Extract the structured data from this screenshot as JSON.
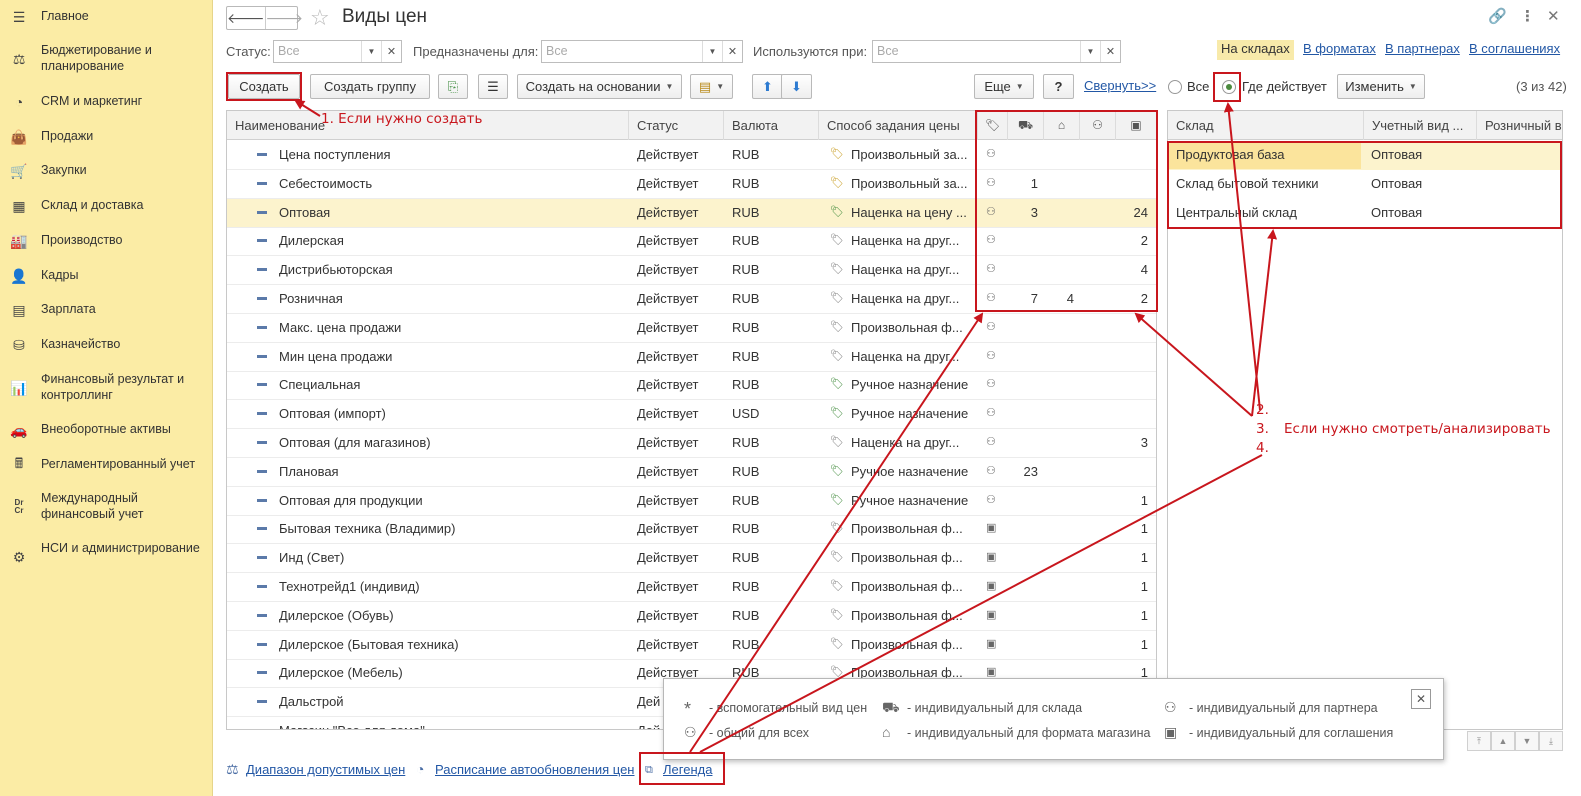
{
  "sidebar": {
    "items": [
      {
        "label": "Главное",
        "icon": "menu-icon"
      },
      {
        "label": "Бюджетирование и планирование",
        "icon": "budget-icon"
      },
      {
        "label": "CRM и маркетинг",
        "icon": "pie-icon"
      },
      {
        "label": "Продажи",
        "icon": "bag-icon"
      },
      {
        "label": "Закупки",
        "icon": "cart-icon"
      },
      {
        "label": "Склад и доставка",
        "icon": "grid-icon"
      },
      {
        "label": "Производство",
        "icon": "factory-icon"
      },
      {
        "label": "Кадры",
        "icon": "person-icon"
      },
      {
        "label": "Зарплата",
        "icon": "list-icon"
      },
      {
        "label": "Казначейство",
        "icon": "coins-icon"
      },
      {
        "label": "Финансовый результат и контроллинг",
        "icon": "chart-icon"
      },
      {
        "label": "Внеоборотные активы",
        "icon": "car-icon"
      },
      {
        "label": "Регламентированный учет",
        "icon": "calculator-icon"
      },
      {
        "label": "Международный финансовый учет",
        "icon": "drcr-icon"
      },
      {
        "label": "НСИ и администрирование",
        "icon": "gear-icon"
      }
    ],
    "drcr": "Dr\nCr"
  },
  "header": {
    "title": "Виды цен",
    "back": "🡐",
    "forward": "🡒"
  },
  "filters": {
    "status_label": "Статус:",
    "status_placeholder": "Все",
    "purpose_label": "Предназначены для:",
    "purpose_placeholder": "Все",
    "used_label": "Используются при:",
    "used_placeholder": "Все",
    "tabs": [
      "На складах",
      "В форматах",
      "В партнерах",
      "В соглашениях"
    ]
  },
  "toolbar": {
    "create": "Создать",
    "create_group": "Создать группу",
    "create_based": "Создать на основании",
    "more": "Еще",
    "help": "?",
    "collapse": "Свернуть>>",
    "radio_all": "Все",
    "radio_where": "Где действует",
    "change": "Изменить",
    "count": "(3 из 42)"
  },
  "table": {
    "columns": [
      "Наименование",
      "Статус",
      "Валюта",
      "Способ задания цены"
    ],
    "rows": [
      {
        "name": "Цена поступления",
        "status": "Действует",
        "currency": "RUB",
        "method": "Произвольный за...",
        "m": "manual",
        "icon": "all",
        "c1": "",
        "c2": "",
        "c3": "",
        "c4": ""
      },
      {
        "name": "Себестоимость",
        "status": "Действует",
        "currency": "RUB",
        "method": "Произвольный за...",
        "m": "manual",
        "icon": "all",
        "c1": "1",
        "c2": "",
        "c3": "",
        "c4": ""
      },
      {
        "name": "Оптовая",
        "status": "Действует",
        "currency": "RUB",
        "method": "Наценка на цену ...",
        "m": "markup",
        "icon": "all",
        "c1": "3",
        "c2": "",
        "c3": "",
        "c4": "24"
      },
      {
        "name": "Дилерская",
        "status": "Действует",
        "currency": "RUB",
        "method": "Наценка на друг...",
        "m": "other",
        "icon": "all",
        "c1": "",
        "c2": "",
        "c3": "",
        "c4": "2"
      },
      {
        "name": "Дистрибьюторская",
        "status": "Действует",
        "currency": "RUB",
        "method": "Наценка на друг...",
        "m": "other",
        "icon": "all",
        "c1": "",
        "c2": "",
        "c3": "",
        "c4": "4"
      },
      {
        "name": "Розничная",
        "status": "Действует",
        "currency": "RUB",
        "method": "Наценка на друг...",
        "m": "other",
        "icon": "all",
        "c1": "7",
        "c2": "4",
        "c3": "",
        "c4": "2"
      },
      {
        "name": "Макс. цена продажи",
        "status": "Действует",
        "currency": "RUB",
        "method": "Произвольная ф...",
        "m": "other",
        "icon": "all",
        "c1": "",
        "c2": "",
        "c3": "",
        "c4": ""
      },
      {
        "name": "Мин цена продажи",
        "status": "Действует",
        "currency": "RUB",
        "method": "Наценка на друг...",
        "m": "other",
        "icon": "all",
        "c1": "",
        "c2": "",
        "c3": "",
        "c4": ""
      },
      {
        "name": "Специальная",
        "status": "Действует",
        "currency": "RUB",
        "method": "Ручное назначение",
        "m": "markup",
        "icon": "all",
        "c1": "",
        "c2": "",
        "c3": "",
        "c4": ""
      },
      {
        "name": "Оптовая (импорт)",
        "status": "Действует",
        "currency": "USD",
        "method": "Ручное назначение",
        "m": "markup",
        "icon": "all",
        "c1": "",
        "c2": "",
        "c3": "",
        "c4": ""
      },
      {
        "name": "Оптовая (для магазинов)",
        "status": "Действует",
        "currency": "RUB",
        "method": "Наценка на друг...",
        "m": "other",
        "icon": "all",
        "c1": "",
        "c2": "",
        "c3": "",
        "c4": "3"
      },
      {
        "name": "Плановая",
        "status": "Действует",
        "currency": "RUB",
        "method": "Ручное назначение",
        "m": "markup",
        "icon": "all",
        "c1": "23",
        "c2": "",
        "c3": "",
        "c4": ""
      },
      {
        "name": "Оптовая для продукции",
        "status": "Действует",
        "currency": "RUB",
        "method": "Ручное назначение",
        "m": "markup",
        "icon": "all",
        "c1": "",
        "c2": "",
        "c3": "",
        "c4": "1"
      },
      {
        "name": "Бытовая техника (Владимир)",
        "status": "Действует",
        "currency": "RUB",
        "method": "Произвольная ф...",
        "m": "other",
        "icon": "agreement",
        "c1": "",
        "c2": "",
        "c3": "",
        "c4": "1"
      },
      {
        "name": "Инд (Свет)",
        "status": "Действует",
        "currency": "RUB",
        "method": "Произвольная ф...",
        "m": "other",
        "icon": "agreement",
        "c1": "",
        "c2": "",
        "c3": "",
        "c4": "1"
      },
      {
        "name": "Технотрейд1 (индивид)",
        "status": "Действует",
        "currency": "RUB",
        "method": "Произвольная ф...",
        "m": "other",
        "icon": "agreement",
        "c1": "",
        "c2": "",
        "c3": "",
        "c4": "1"
      },
      {
        "name": "Дилерское (Обувь)",
        "status": "Действует",
        "currency": "RUB",
        "method": "Произвольная ф...",
        "m": "other",
        "icon": "agreement",
        "c1": "",
        "c2": "",
        "c3": "",
        "c4": "1"
      },
      {
        "name": "Дилерское (Бытовая техника)",
        "status": "Действует",
        "currency": "RUB",
        "method": "Произвольная ф...",
        "m": "other",
        "icon": "agreement",
        "c1": "",
        "c2": "",
        "c3": "",
        "c4": "1"
      },
      {
        "name": "Дилерское (Мебель)",
        "status": "Действует",
        "currency": "RUB",
        "method": "Произвольная ф...",
        "m": "other",
        "icon": "agreement",
        "c1": "",
        "c2": "",
        "c3": "",
        "c4": "1"
      },
      {
        "name": "Дальстрой",
        "status": "Дей",
        "currency": "",
        "method": "",
        "m": "",
        "icon": "",
        "c1": "",
        "c2": "",
        "c3": "",
        "c4": ""
      },
      {
        "name": "Магазин \"Все для дома\"",
        "status": "Дей",
        "currency": "",
        "method": "",
        "m": "",
        "icon": "",
        "c1": "",
        "c2": "",
        "c3": "",
        "c4": ""
      }
    ]
  },
  "right": {
    "columns": [
      "Склад",
      "Учетный вид ...",
      "Розничный в"
    ],
    "rows": [
      {
        "warehouse": "Продуктовая база",
        "kind": "Оптовая"
      },
      {
        "warehouse": "Склад бытовой техники",
        "kind": "Оптовая"
      },
      {
        "warehouse": "Центральный склад",
        "kind": "Оптовая"
      }
    ]
  },
  "bottom": {
    "range": "Диапазон допустимых цен",
    "schedule": "Расписание автообновления цен",
    "legend": "Легенда"
  },
  "legend": {
    "aux": "- вспомогательный вид цен",
    "common": "- общий для всех",
    "warehouse": "- индивидуальный для склада",
    "store_format": "- индивидуальный для формата магазина",
    "partner": "- индивидуальный для партнера",
    "agreement": "- индивидуальный для соглашения",
    "close": "✕"
  },
  "annotations": {
    "note1": "1. Если нужно создать",
    "n2": "2.",
    "n3": "3.",
    "n4": "4.",
    "note2": "Если нужно смотреть/анализировать",
    "color": "#c8161d"
  }
}
